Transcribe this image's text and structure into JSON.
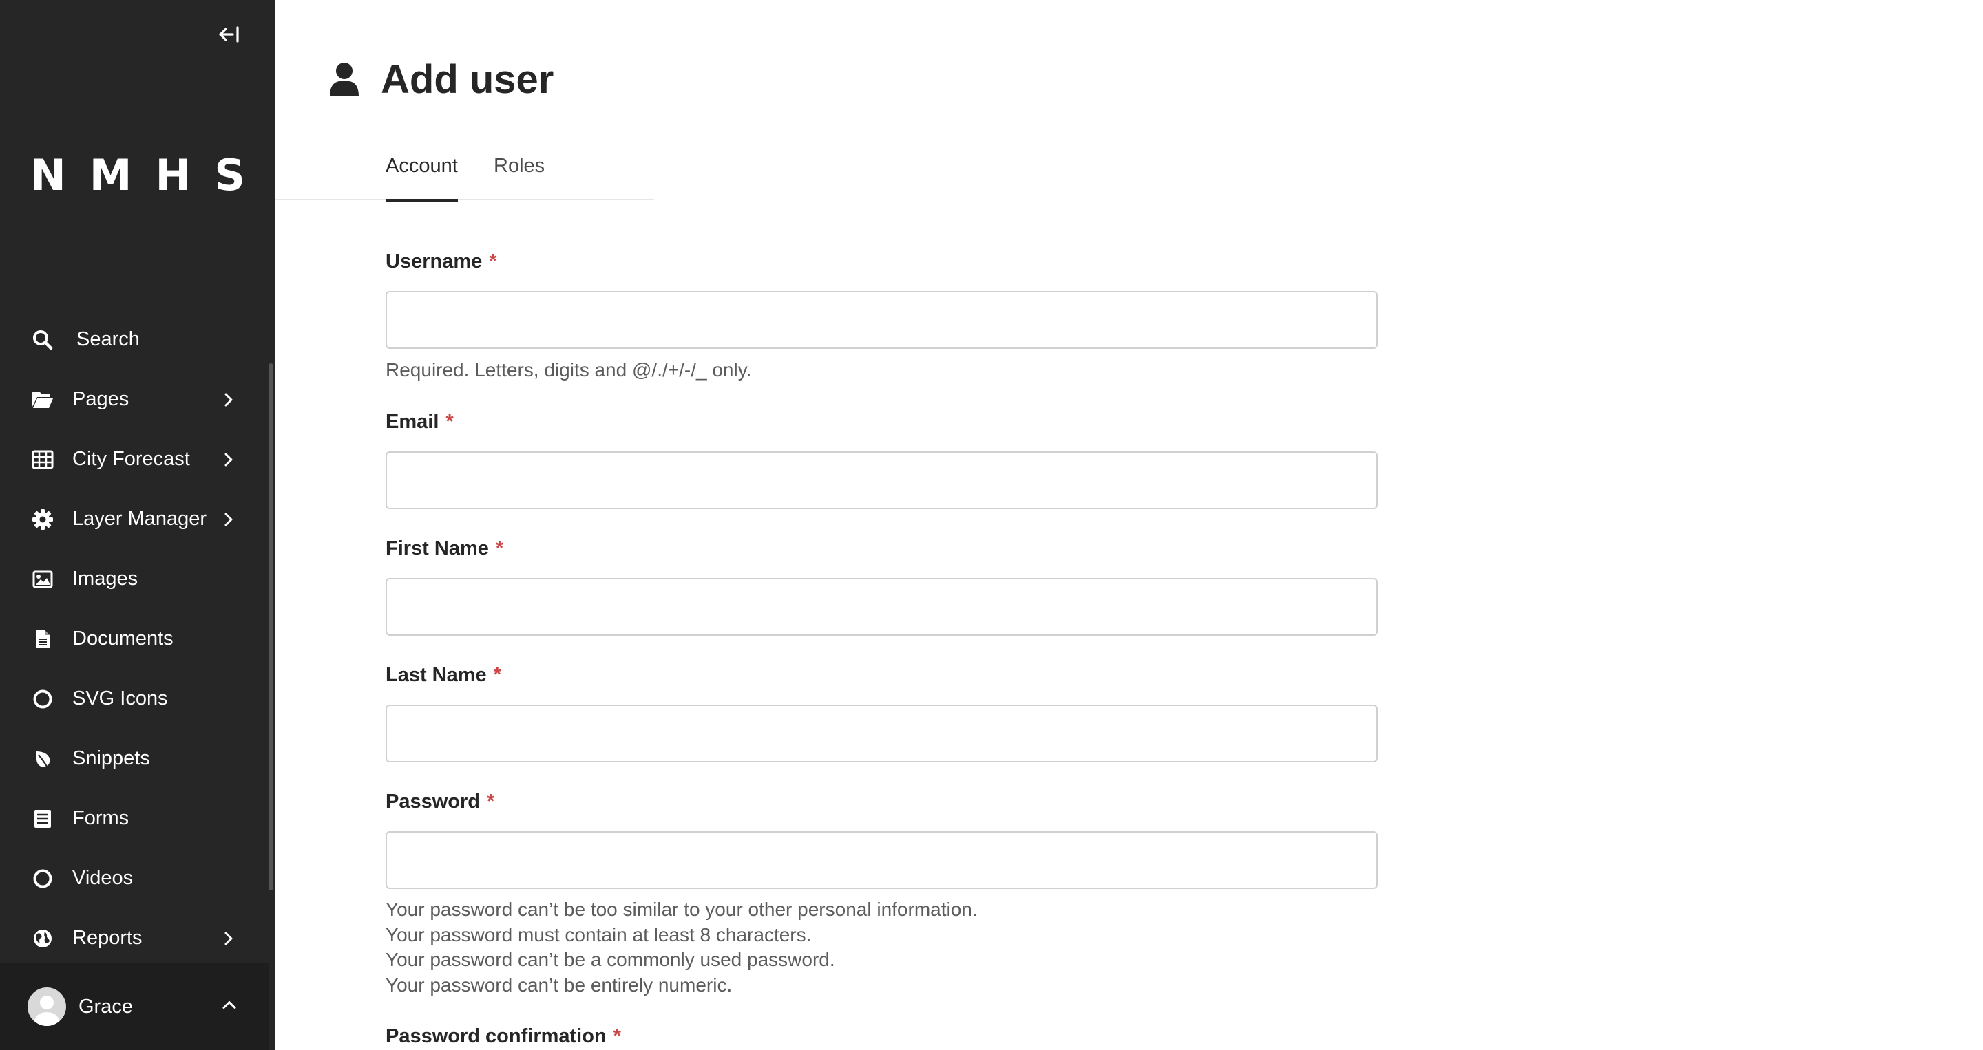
{
  "sidebar": {
    "logo": "NMHS",
    "items": [
      {
        "label": "Search",
        "icon": "search-icon",
        "has_submenu": false
      },
      {
        "label": "Pages",
        "icon": "folder-open-icon",
        "has_submenu": true
      },
      {
        "label": "City Forecast",
        "icon": "table-icon",
        "has_submenu": true
      },
      {
        "label": "Layer Manager",
        "icon": "cog-icon",
        "has_submenu": true
      },
      {
        "label": "Images",
        "icon": "image-icon",
        "has_submenu": false
      },
      {
        "label": "Documents",
        "icon": "document-icon",
        "has_submenu": false
      },
      {
        "label": "SVG Icons",
        "icon": "circle-icon",
        "has_submenu": false
      },
      {
        "label": "Snippets",
        "icon": "leaf-icon",
        "has_submenu": false
      },
      {
        "label": "Forms",
        "icon": "form-icon",
        "has_submenu": false
      },
      {
        "label": "Videos",
        "icon": "circle-icon",
        "has_submenu": false
      },
      {
        "label": "Reports",
        "icon": "globe-icon",
        "has_submenu": true
      }
    ],
    "account": {
      "name": "Grace"
    }
  },
  "header": {
    "title": "Add user",
    "icon": "user-icon"
  },
  "tabs": [
    {
      "label": "Account",
      "active": true
    },
    {
      "label": "Roles",
      "active": false
    }
  ],
  "form": {
    "required_mark": "*",
    "username": {
      "label": "Username",
      "value": "",
      "help": "Required. Letters, digits and @/./+/-/_ only."
    },
    "email": {
      "label": "Email",
      "value": ""
    },
    "first_name": {
      "label": "First Name",
      "value": ""
    },
    "last_name": {
      "label": "Last Name",
      "value": ""
    },
    "password": {
      "label": "Password",
      "value": "",
      "help": [
        "Your password can’t be too similar to your other personal information.",
        "Your password must contain at least 8 characters.",
        "Your password can’t be a commonly used password.",
        "Your password can’t be entirely numeric."
      ]
    },
    "password_confirmation": {
      "label": "Password confirmation"
    }
  }
}
